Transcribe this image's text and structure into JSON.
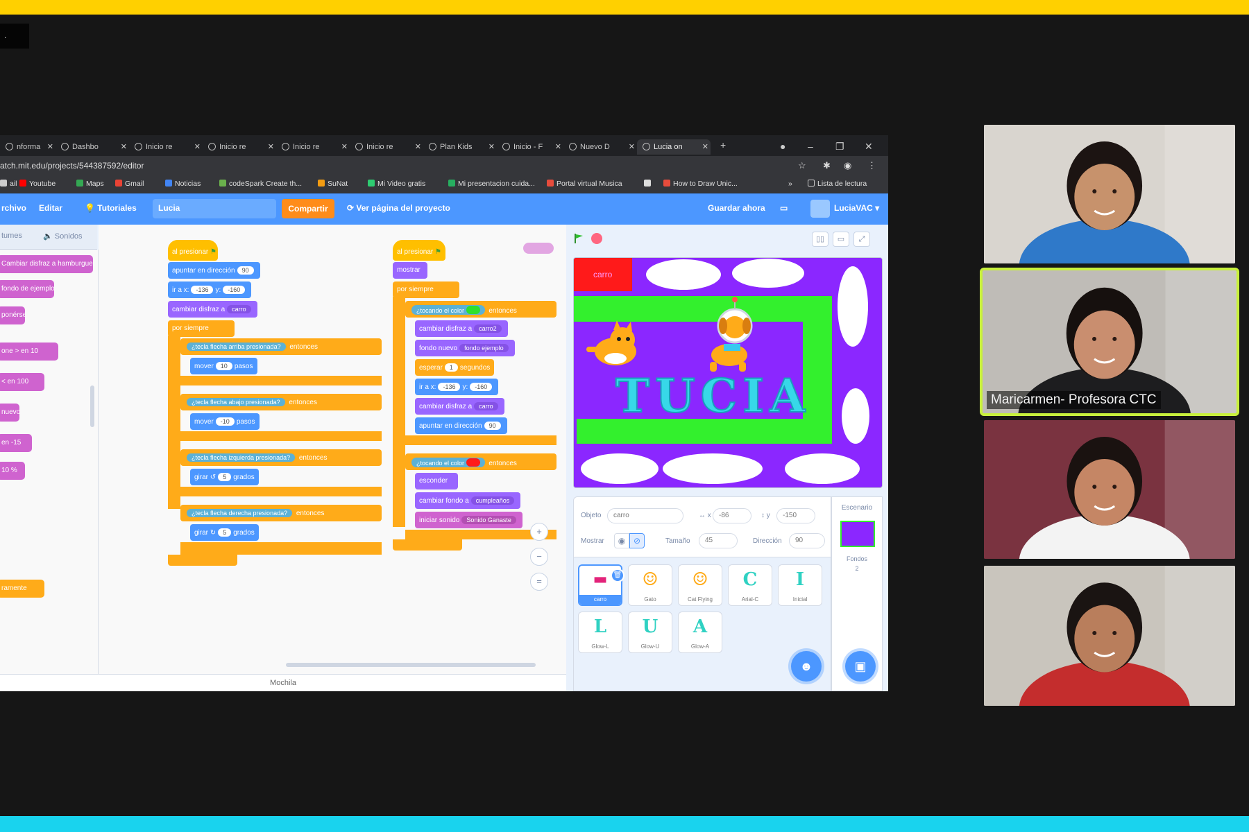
{
  "colors": {
    "top_bar": "#ffd000",
    "bottom_bar": "#19d3ee",
    "scratch_blue": "#4c97ff",
    "stage_purple": "#8b27ff",
    "stage_green": "#33f02d",
    "active_speaker": "#c8f03c"
  },
  "corner_tag": ".",
  "browser": {
    "tabs": [
      {
        "label": "nforma",
        "icon": "doc-icon"
      },
      {
        "label": "Dashbo",
        "icon": "dashboard-icon"
      },
      {
        "label": "Inicio re",
        "icon": "globe-icon"
      },
      {
        "label": "Inicio re",
        "icon": "globe-icon"
      },
      {
        "label": "Inicio re",
        "icon": "globe-icon"
      },
      {
        "label": "Inicio re",
        "icon": "globe-icon"
      },
      {
        "label": "Plan Kids",
        "icon": "plan-icon"
      },
      {
        "label": "Inicio - F",
        "icon": "doc-icon"
      },
      {
        "label": "Nuevo D",
        "icon": "globe-icon"
      },
      {
        "label": "Lucia on",
        "icon": "scratch-icon"
      }
    ],
    "url": "atch.mit.edu/projects/544387592/editor",
    "bookmarks": [
      {
        "label": "ail",
        "color": "#cccccc"
      },
      {
        "label": "Youtube",
        "color": "#ff0000"
      },
      {
        "label": "Maps",
        "color": "#34a853"
      },
      {
        "label": "Gmail",
        "color": "#ea4335"
      },
      {
        "label": "Noticias",
        "color": "#4285f4"
      },
      {
        "label": "codeSpark Create th...",
        "color": "#6ab04c"
      },
      {
        "label": "SuNat",
        "color": "#f39c12"
      },
      {
        "label": "Mi Video gratis",
        "color": "#2ecc71"
      },
      {
        "label": "Mi presentacion cuida...",
        "color": "#27ae60"
      },
      {
        "label": "Portal virtual Musica",
        "color": "#e74c3c"
      },
      {
        "label": "",
        "color": "#dddddd"
      },
      {
        "label": "How to Draw Unic...",
        "color": "#e74c3c"
      }
    ],
    "reading_list": "Lista de lectura"
  },
  "scratch": {
    "menu": {
      "file": "rchivo",
      "edit": "Editar",
      "tutorials": "Tutoriales",
      "project_title": "Lucia",
      "share": "Compartir",
      "see_project_page": "Ver página del proyecto",
      "save_now": "Guardar ahora",
      "username": "LuciaVAC"
    },
    "palette_tabs": {
      "costumes": "tumes",
      "sounds": "Sonidos"
    },
    "palette_blocks": [
      "Cambiar disfraz a  hamburguesa",
      "fondo de ejemplo",
      "ponérse",
      "one  >  en  10",
      "  <  en  100",
      "nuevo",
      "en  -15",
      "10  %",
      "ramente"
    ],
    "script1": {
      "hat": "al presionar",
      "b1": "apuntar en dirección",
      "b1v": "90",
      "b2": "ir a x:",
      "b2x": "-136",
      "b2y": "-160",
      "b3": "cambiar disfraz a",
      "b3v": "carro",
      "forever": "por siempre",
      "if1": "¿tecla  flecha arriba  presionada?",
      "if1s": "entonces",
      "m1": "mover",
      "m1v": "10",
      "m1u": "pasos",
      "if2": "¿tecla  flecha abajo  presionada?",
      "m2": "mover",
      "m2v": "-10",
      "m2u": "pasos",
      "if3": "¿tecla  flecha izquierda  presionada?",
      "t1": "girar",
      "t1v": "5",
      "t1u": "grados",
      "if4": "¿tecla  flecha derecha  presionada?",
      "t2": "girar",
      "t2v": "5",
      "t2u": "grados"
    },
    "script2": {
      "hat": "al presionar",
      "b1": "mostrar",
      "forever": "por siempre",
      "if1": "¿tocando el color",
      "if1s": "entonces",
      "c1": "cambiar disfraz a",
      "c1v": "carro2",
      "c2": "fondo nuevo",
      "c2v": "fondo ejemplo",
      "c3": "esperar",
      "c3v": "1",
      "c3u": "segundos",
      "c4": "ir a x:",
      "c4x": "-136",
      "c4y": "-160",
      "c5": "cambiar disfraz a",
      "c5v": "carro",
      "c6": "apuntar en dirección",
      "c6v": "90",
      "if2": "¿tocando el color",
      "d1": "esconder",
      "d2": "cambiar fondo a",
      "d2v": "cumpleaños",
      "d3": "iniciar sonido",
      "d3v": "Sonido Ganaste"
    },
    "backpack": "Mochila",
    "stage_text": "TUCIA",
    "stage_car_label": "carro",
    "sprite_info": {
      "sprite_label": "Objeto",
      "sprite_name": "carro",
      "x_label": "x",
      "x_value": "-86",
      "y_label": "y",
      "y_value": "-150",
      "show_label": "Mostrar",
      "size_label": "Tamaño",
      "size_value": "45",
      "direction_label": "Dirección",
      "direction_value": "90"
    },
    "sprites": [
      "carro",
      "Gato",
      "Cat Flying",
      "Arial-C",
      "Inicial",
      "Glow-L",
      "Glow-U",
      "Glow-A"
    ],
    "stage_panel": {
      "label": "Escenario",
      "backdrops_label": "Fondos",
      "backdrops_count": "2"
    }
  },
  "participants": [
    {
      "name": "",
      "shirt": "#2f79c9",
      "wall": "#d9d5cf",
      "skin": "#c7926c",
      "hair": "#1c1412"
    },
    {
      "name": "Maricarmen- Profesora CTC",
      "shirt": "#1d1d1f",
      "wall": "#bfbcb7",
      "skin": "#c98e6f",
      "hair": "#16100e"
    },
    {
      "name": "",
      "shirt": "#f3f3f3",
      "wall": "#7a3340",
      "skin": "#c58665",
      "hair": "#1a1210"
    },
    {
      "name": "",
      "shirt": "#c42d2d",
      "wall": "#c9c5bd",
      "skin": "#b97e5c",
      "hair": "#1a1412"
    }
  ]
}
